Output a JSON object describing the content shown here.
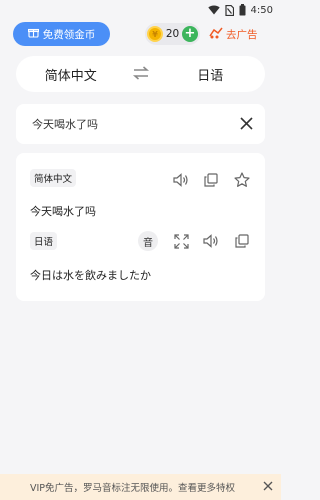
{
  "status_bar": {
    "time": "4:50",
    "icons": [
      "wifi-icon",
      "no-sim-icon",
      "battery-icon"
    ]
  },
  "header": {
    "coin_button_label": "免费领金币",
    "coin_count": "20",
    "ad_link_label": "去广告"
  },
  "language_bar": {
    "source": "简体中文",
    "target": "日语",
    "swap_icon": "swap-arrows-icon"
  },
  "input": {
    "text": "今天喝水了吗",
    "clear_icon": "close-icon"
  },
  "result": {
    "source_tag": "简体中文",
    "source_text": "今天喝水了吗",
    "target_tag": "日语",
    "pronunciation_label": "音",
    "target_text": "今日は水を飲みましたか",
    "icons": [
      "speaker-icon",
      "copy-icon",
      "star-icon",
      "fullscreen-icon"
    ]
  },
  "vip_banner": {
    "text": "VIP免广告，罗马音标注无限使用。查看更多特权"
  },
  "colors": {
    "accent_blue": "#4b8ff7",
    "ad_orange": "#f05a24",
    "coin_gold": "#f5b400",
    "plus_green": "#3cb55c",
    "banner_bg": "#fdefdc"
  }
}
